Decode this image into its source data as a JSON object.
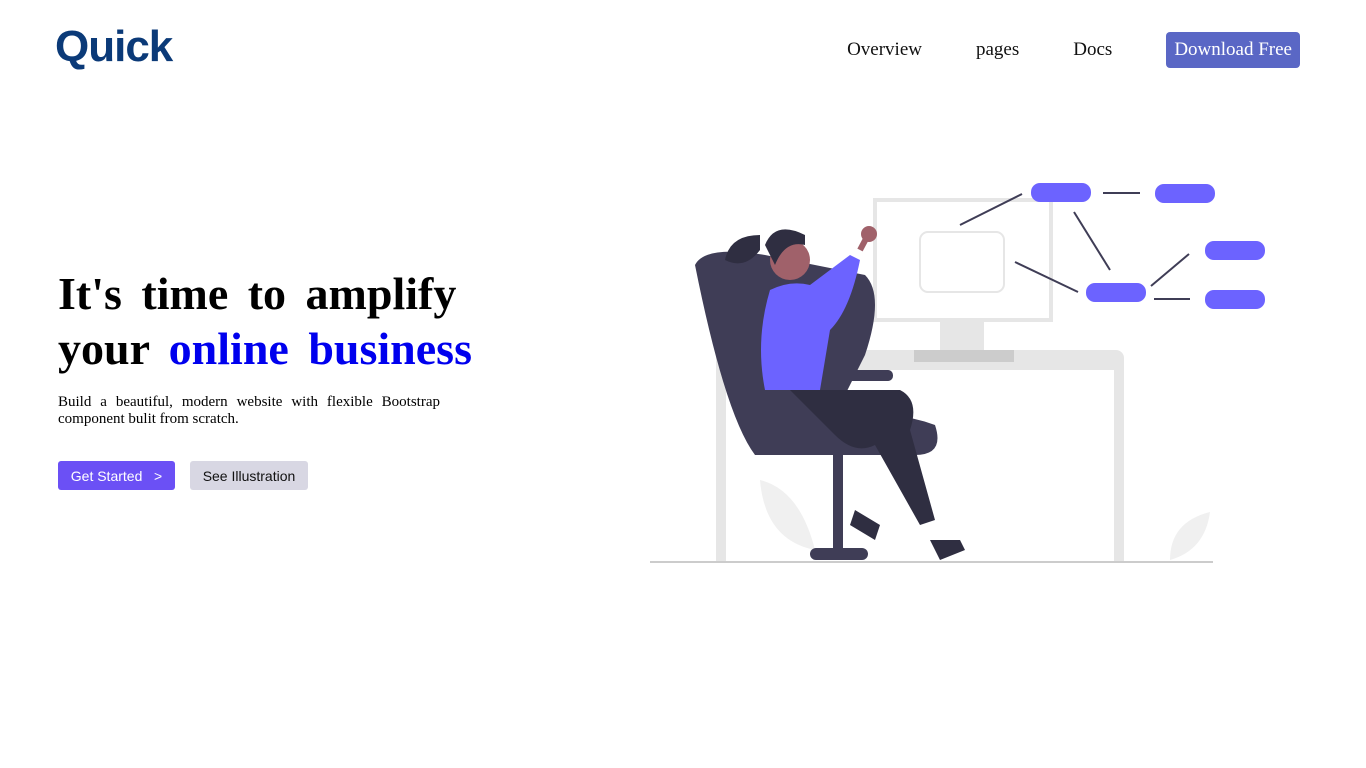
{
  "brand": {
    "logo": "Quick"
  },
  "nav": {
    "items": [
      "Overview",
      "pages",
      "Docs"
    ],
    "download": "Download Free"
  },
  "hero": {
    "title_line1": "It's time to amplify",
    "title_line2_plain": "your",
    "title_line2_highlight": "online business",
    "subtitle": "Build a beautiful, modern website with flexible Bootstrap component bulit from scratch.",
    "primary_button": "Get Started",
    "primary_icon": ">",
    "secondary_button": "See Illustration"
  },
  "colors": {
    "accent": "#6c63ff",
    "brand": "#0b3a78",
    "highlight": "#0000ee",
    "download": "#5a67c5"
  }
}
